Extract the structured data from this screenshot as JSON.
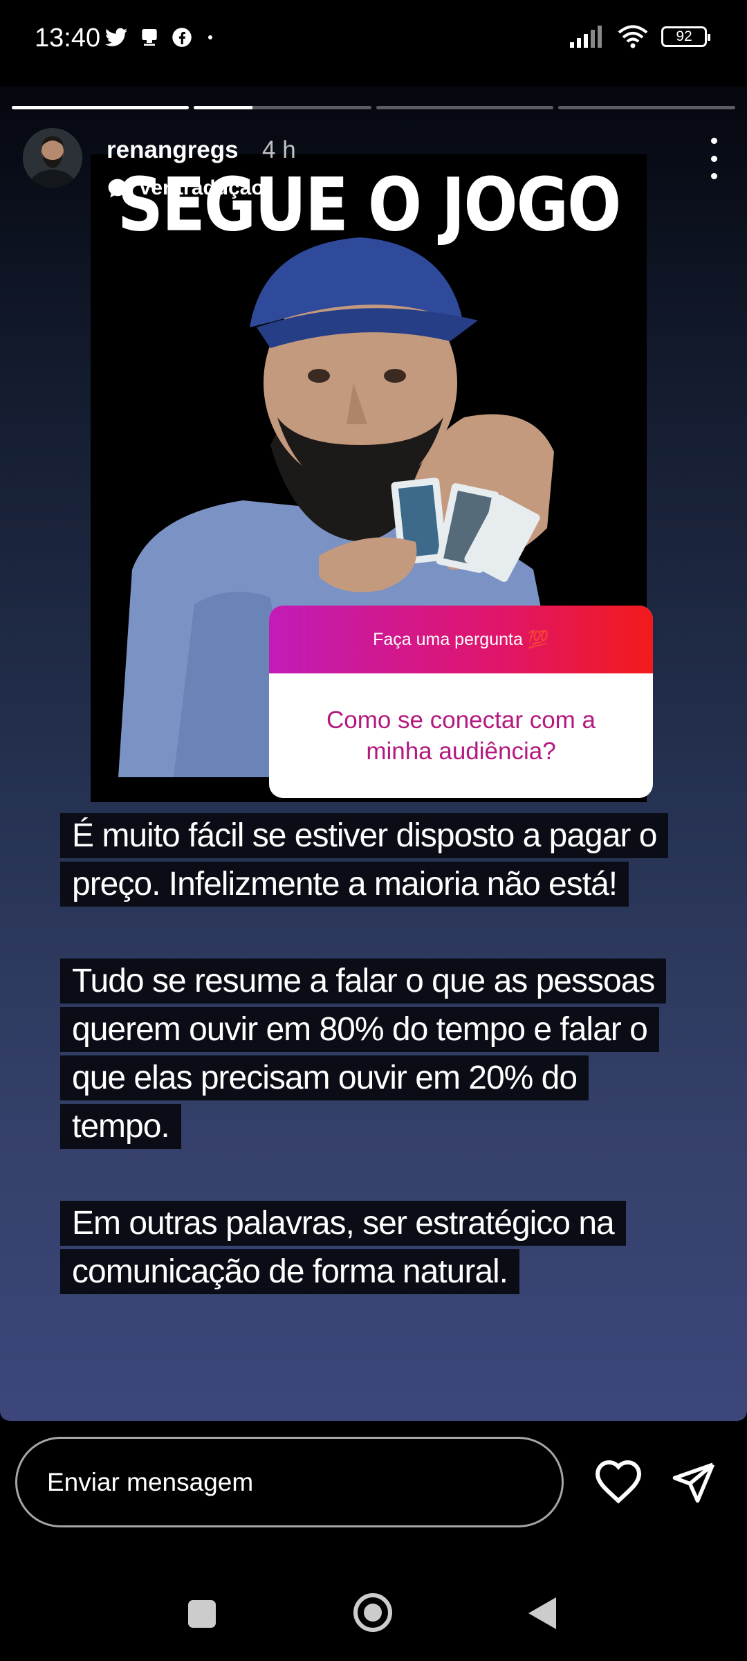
{
  "status_bar": {
    "time": "13:40",
    "left_icons": [
      "twitter-icon",
      "notification-icon",
      "facebook-icon"
    ],
    "right_icons": [
      "signal-icon",
      "wifi-icon"
    ],
    "battery": "92"
  },
  "story": {
    "progress": [
      1.0,
      0.33,
      0.0,
      0.0
    ],
    "username": "renangregs",
    "time_ago": "4 h",
    "translate_label": "Ver tradução",
    "image_caption": "SEGUE O JOGO",
    "question": {
      "prompt": "Faça uma pergunta 💯",
      "text": "Como se conectar  com a minha audiência?"
    },
    "paragraphs": [
      "É muito fácil se estiver disposto a pagar o preço. Infelizmente a maioria não está!",
      "Tudo se resume a falar o que as pessoas querem ouvir em 80% do tempo e falar o que elas precisam ouvir em 20% do tempo.",
      "Em outras palavras, ser estratégico na comunicação de forma natural."
    ]
  },
  "reply": {
    "placeholder": "Enviar mensagem"
  },
  "colors": {
    "question_gradient_start": "#c11cb7",
    "question_gradient_end": "#f21b1b",
    "question_text": "#b3197f",
    "text_bg": "#0a0d16"
  }
}
